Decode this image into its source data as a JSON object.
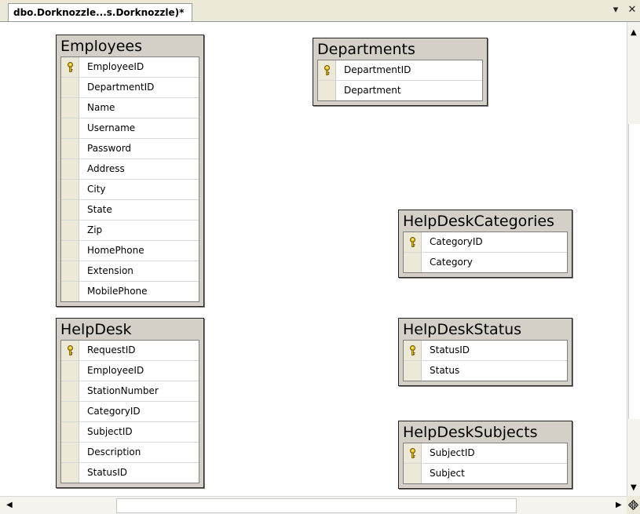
{
  "tab": {
    "title": "dbo.Dorknozzle...s.Dorknozzle)*",
    "dropdown_glyph": "▾",
    "close_glyph": "✕"
  },
  "tables": {
    "employees": {
      "name": "Employees",
      "columns": [
        {
          "name": "EmployeeID",
          "key": true
        },
        {
          "name": "DepartmentID",
          "key": false
        },
        {
          "name": "Name",
          "key": false
        },
        {
          "name": "Username",
          "key": false
        },
        {
          "name": "Password",
          "key": false
        },
        {
          "name": "Address",
          "key": false
        },
        {
          "name": "City",
          "key": false
        },
        {
          "name": "State",
          "key": false
        },
        {
          "name": "Zip",
          "key": false
        },
        {
          "name": "HomePhone",
          "key": false
        },
        {
          "name": "Extension",
          "key": false
        },
        {
          "name": "MobilePhone",
          "key": false
        }
      ]
    },
    "departments": {
      "name": "Departments",
      "columns": [
        {
          "name": "DepartmentID",
          "key": true
        },
        {
          "name": "Department",
          "key": false
        }
      ]
    },
    "helpdeskcategories": {
      "name": "HelpDeskCategories",
      "columns": [
        {
          "name": "CategoryID",
          "key": true
        },
        {
          "name": "Category",
          "key": false
        }
      ]
    },
    "helpdesk": {
      "name": "HelpDesk",
      "columns": [
        {
          "name": "RequestID",
          "key": true
        },
        {
          "name": "EmployeeID",
          "key": false
        },
        {
          "name": "StationNumber",
          "key": false
        },
        {
          "name": "CategoryID",
          "key": false
        },
        {
          "name": "SubjectID",
          "key": false
        },
        {
          "name": "Description",
          "key": false
        },
        {
          "name": "StatusID",
          "key": false
        }
      ]
    },
    "helpdeskstatus": {
      "name": "HelpDeskStatus",
      "columns": [
        {
          "name": "StatusID",
          "key": true
        },
        {
          "name": "Status",
          "key": false
        }
      ]
    },
    "helpdesksubjects": {
      "name": "HelpDeskSubjects",
      "columns": [
        {
          "name": "SubjectID",
          "key": true
        },
        {
          "name": "Subject",
          "key": false
        }
      ]
    }
  },
  "icons": {
    "key": "key-icon",
    "dropdown": "chevron-down-icon",
    "close": "close-icon",
    "scroll_up": "arrow-up-icon",
    "scroll_down": "arrow-down-icon",
    "scroll_left": "arrow-left-icon",
    "scroll_right": "arrow-right-icon",
    "pan": "move-icon"
  },
  "colors": {
    "table_frame": "#d4d0c8",
    "key": "#e8b400"
  }
}
